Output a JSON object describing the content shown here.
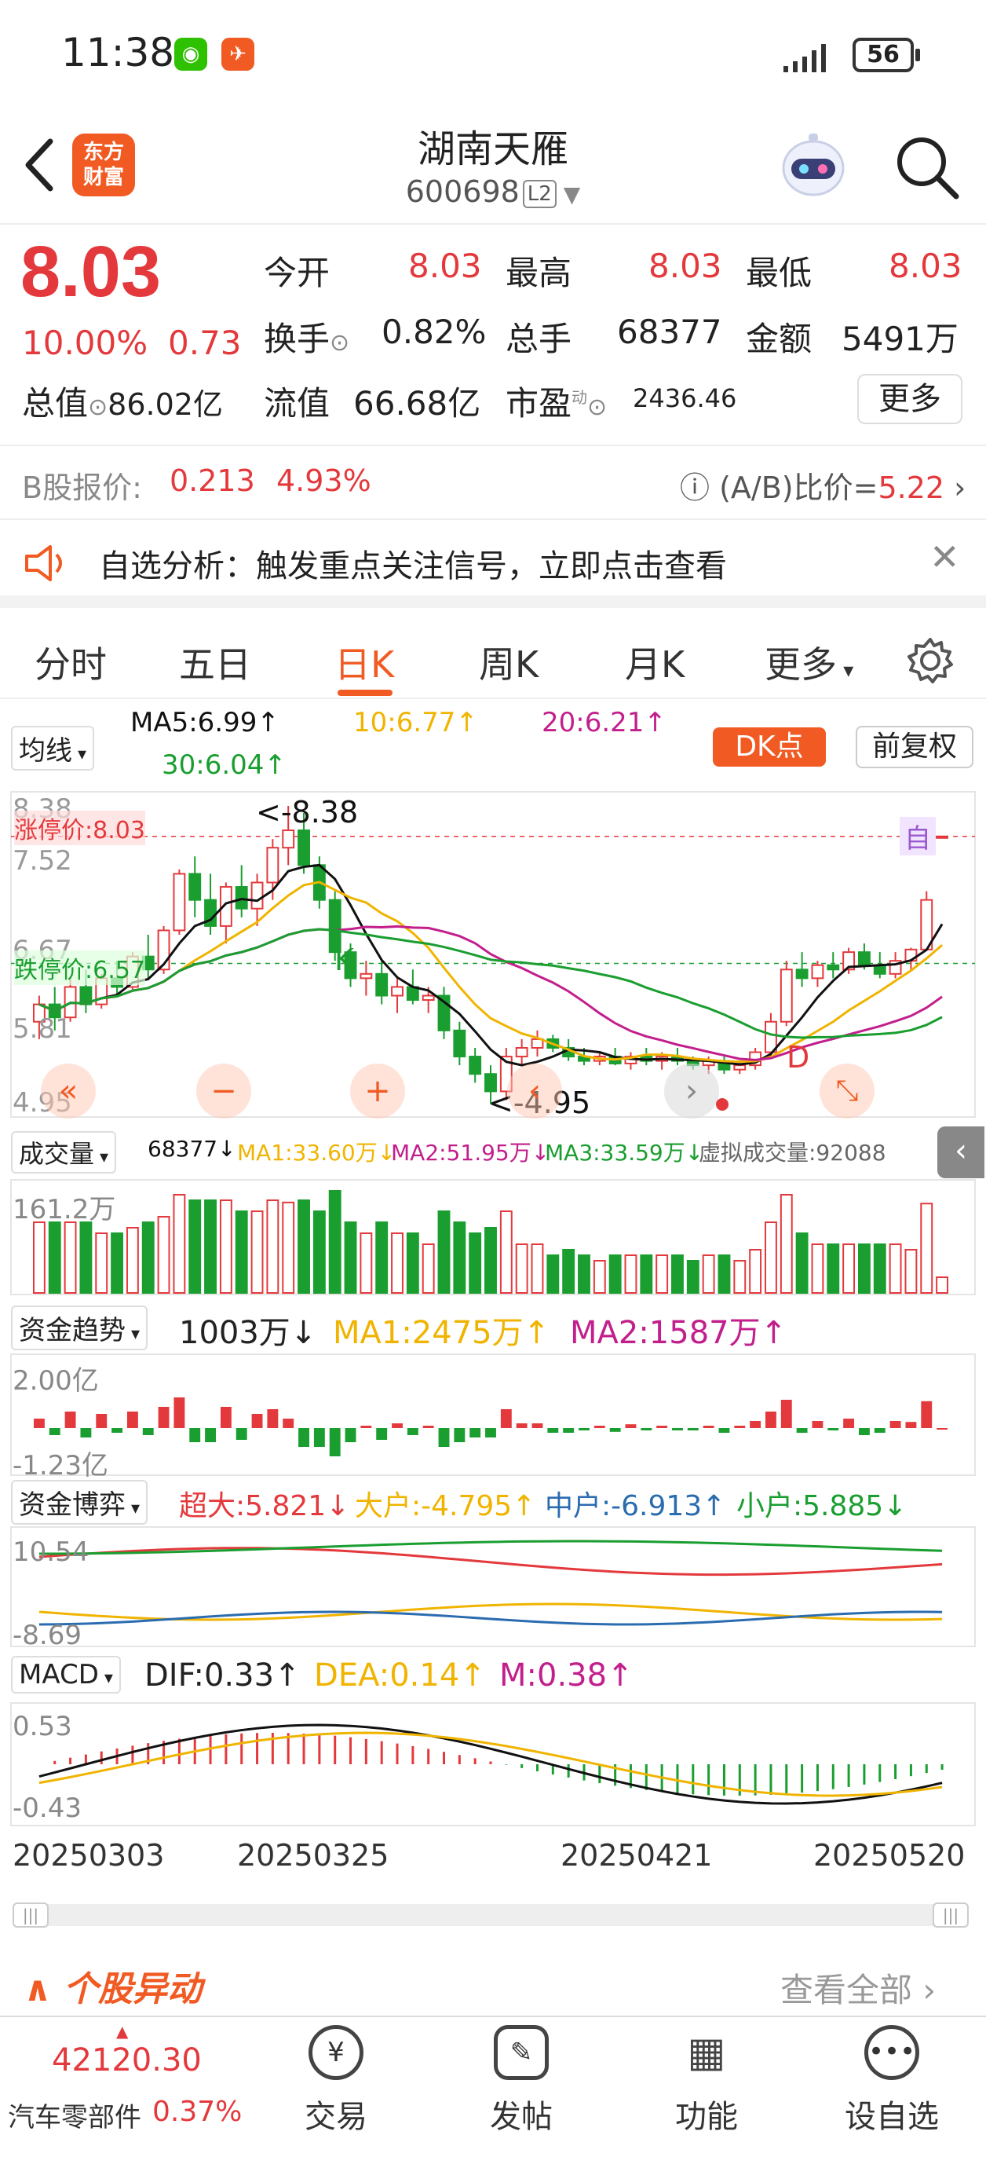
{
  "status": {
    "time": "11:38",
    "battery": "56"
  },
  "header": {
    "title": "湖南天雁",
    "code": "600698",
    "level": "L2",
    "logo_line1": "东方",
    "logo_line2": "财富"
  },
  "quote": {
    "price": "8.03",
    "pct": "10.00%",
    "chg": "0.73",
    "open_label": "今开",
    "open": "8.03",
    "high_label": "最高",
    "high": "8.03",
    "low_label": "最低",
    "low": "8.03",
    "turnover_label": "换手",
    "turnover": "0.82%",
    "vol_label": "总手",
    "vol": "68377",
    "amount_label": "金额",
    "amount": "5491万",
    "mcap_label": "总值",
    "mcap": "86.02亿",
    "float_label": "流值",
    "float": "66.68亿",
    "pe_label": "市盈",
    "pe_sup": "动",
    "pe": "2436.46",
    "more": "更多"
  },
  "bshare": {
    "label": "B股报价:",
    "price": "0.213",
    "pct": "4.93%",
    "ratio_label": "(A/B)比价=",
    "ratio": "5.22"
  },
  "banner": {
    "text": "自选分析：触发重点关注信号，立即点击查看"
  },
  "tabs": [
    "分时",
    "五日",
    "日K",
    "周K",
    "月K",
    "更多"
  ],
  "kchart": {
    "ma_select": "均线",
    "ma5": "MA5:6.99",
    "ma10": "10:6.77",
    "ma20": "20:6.21",
    "ma30": "30:6.04",
    "dk": "DK点",
    "adjust": "前复权",
    "limit_up": "涨停价:8.03",
    "limit_down": "跌停价:6.57",
    "y_top": "8.38",
    "y_2": "7.52",
    "y_3": "6.67",
    "y_4": "5.81",
    "y_bottom": "4.95",
    "max_tag": "<-8.38",
    "min_tag": "<-4.95",
    "self_tag": "自",
    "d_tag": "D",
    "k_tag": "K"
  },
  "volume": {
    "select": "成交量",
    "value": "68377",
    "ma1": "MA1:33.60万",
    "ma2": "MA2:51.95万",
    "ma3": "MA3:33.59万",
    "virtual": "虚拟成交量:92088",
    "y_top": "161.2万"
  },
  "fund": {
    "select": "资金趋势",
    "value": "1003万",
    "ma1": "MA1:2475万",
    "ma2": "MA2:1587万",
    "y_top": "2.00亿",
    "y_bottom": "-1.23亿"
  },
  "game": {
    "select": "资金博弈",
    "super": "超大:5.821",
    "big": "大户:-4.795",
    "mid": "中户:-6.913",
    "small": "小户:5.885",
    "y_top": "10.54",
    "y_bottom": "-8.69"
  },
  "macd": {
    "select": "MACD",
    "dif": "DIF:0.33",
    "dea": "DEA:0.14",
    "m": "M:0.38",
    "y_top": "0.53",
    "y_bottom": "-0.43"
  },
  "dates": [
    "20250303",
    "20250325",
    "20250421",
    "20250520"
  ],
  "movement": {
    "title": "个股异动",
    "link": "查看全部"
  },
  "bottom": {
    "index_value": "42120.30",
    "index_name": "汽车零部件",
    "index_pct": "0.37%",
    "trade": "交易",
    "post": "发帖",
    "func": "功能",
    "watch": "设自选"
  },
  "colors": {
    "up": "#e4393c",
    "down": "#1a9e30",
    "accent": "#f15a22",
    "ma5": "#111111",
    "ma10": "#f0b400",
    "ma20": "#c21f8c",
    "ma30": "#1a9e30"
  },
  "chart_data": {
    "type": "candlestick",
    "days": [
      {
        "o": 5.9,
        "h": 6.2,
        "l": 5.7,
        "c": 6.1
      },
      {
        "o": 6.1,
        "h": 6.3,
        "l": 5.8,
        "c": 5.95
      },
      {
        "o": 5.95,
        "h": 6.4,
        "l": 5.9,
        "c": 6.3
      },
      {
        "o": 6.3,
        "h": 6.5,
        "l": 6.0,
        "c": 6.1
      },
      {
        "o": 6.1,
        "h": 6.45,
        "l": 6.05,
        "c": 6.4
      },
      {
        "o": 6.4,
        "h": 6.6,
        "l": 6.2,
        "c": 6.3
      },
      {
        "o": 6.3,
        "h": 6.7,
        "l": 6.25,
        "c": 6.65
      },
      {
        "o": 6.65,
        "h": 6.9,
        "l": 6.4,
        "c": 6.5
      },
      {
        "o": 6.5,
        "h": 7.0,
        "l": 6.45,
        "c": 6.95
      },
      {
        "o": 6.95,
        "h": 7.65,
        "l": 6.9,
        "c": 7.6
      },
      {
        "o": 7.6,
        "h": 7.8,
        "l": 7.1,
        "c": 7.3
      },
      {
        "o": 7.3,
        "h": 7.6,
        "l": 6.9,
        "c": 7.0
      },
      {
        "o": 7.0,
        "h": 7.5,
        "l": 6.8,
        "c": 7.45
      },
      {
        "o": 7.45,
        "h": 7.7,
        "l": 7.1,
        "c": 7.2
      },
      {
        "o": 7.2,
        "h": 7.6,
        "l": 7.0,
        "c": 7.5
      },
      {
        "o": 7.5,
        "h": 8.0,
        "l": 7.3,
        "c": 7.9
      },
      {
        "o": 7.9,
        "h": 8.38,
        "l": 7.7,
        "c": 8.1
      },
      {
        "o": 8.1,
        "h": 8.3,
        "l": 7.6,
        "c": 7.7
      },
      {
        "o": 7.7,
        "h": 7.8,
        "l": 7.2,
        "c": 7.3
      },
      {
        "o": 7.3,
        "h": 7.4,
        "l": 6.6,
        "c": 6.7
      },
      {
        "o": 6.7,
        "h": 6.8,
        "l": 6.3,
        "c": 6.4
      },
      {
        "o": 6.4,
        "h": 6.6,
        "l": 6.2,
        "c": 6.45
      },
      {
        "o": 6.45,
        "h": 6.6,
        "l": 6.1,
        "c": 6.2
      },
      {
        "o": 6.2,
        "h": 6.4,
        "l": 6.0,
        "c": 6.3
      },
      {
        "o": 6.3,
        "h": 6.5,
        "l": 6.1,
        "c": 6.15
      },
      {
        "o": 6.15,
        "h": 6.3,
        "l": 6.0,
        "c": 6.2
      },
      {
        "o": 6.2,
        "h": 6.3,
        "l": 5.7,
        "c": 5.8
      },
      {
        "o": 5.8,
        "h": 5.9,
        "l": 5.4,
        "c": 5.5
      },
      {
        "o": 5.5,
        "h": 5.6,
        "l": 5.2,
        "c": 5.3
      },
      {
        "o": 5.3,
        "h": 5.4,
        "l": 4.95,
        "c": 5.1
      },
      {
        "o": 5.1,
        "h": 5.6,
        "l": 5.0,
        "c": 5.5
      },
      {
        "o": 5.5,
        "h": 5.7,
        "l": 5.4,
        "c": 5.6
      },
      {
        "o": 5.6,
        "h": 5.8,
        "l": 5.5,
        "c": 5.7
      },
      {
        "o": 5.7,
        "h": 5.75,
        "l": 5.55,
        "c": 5.6
      },
      {
        "o": 5.6,
        "h": 5.7,
        "l": 5.45,
        "c": 5.5
      },
      {
        "o": 5.5,
        "h": 5.6,
        "l": 5.4,
        "c": 5.45
      },
      {
        "o": 5.45,
        "h": 5.55,
        "l": 5.4,
        "c": 5.5
      },
      {
        "o": 5.5,
        "h": 5.6,
        "l": 5.4,
        "c": 5.42
      },
      {
        "o": 5.42,
        "h": 5.55,
        "l": 5.35,
        "c": 5.5
      },
      {
        "o": 5.5,
        "h": 5.6,
        "l": 5.4,
        "c": 5.45
      },
      {
        "o": 5.45,
        "h": 5.55,
        "l": 5.35,
        "c": 5.5
      },
      {
        "o": 5.5,
        "h": 5.6,
        "l": 5.4,
        "c": 5.45
      },
      {
        "o": 5.45,
        "h": 5.5,
        "l": 5.35,
        "c": 5.4
      },
      {
        "o": 5.4,
        "h": 5.5,
        "l": 5.3,
        "c": 5.45
      },
      {
        "o": 5.45,
        "h": 5.5,
        "l": 5.3,
        "c": 5.35
      },
      {
        "o": 5.35,
        "h": 5.45,
        "l": 5.3,
        "c": 5.4
      },
      {
        "o": 5.4,
        "h": 5.6,
        "l": 5.35,
        "c": 5.55
      },
      {
        "o": 5.55,
        "h": 6.0,
        "l": 5.5,
        "c": 5.9
      },
      {
        "o": 5.9,
        "h": 6.6,
        "l": 5.85,
        "c": 6.5
      },
      {
        "o": 6.5,
        "h": 6.7,
        "l": 6.3,
        "c": 6.4
      },
      {
        "o": 6.4,
        "h": 6.6,
        "l": 6.3,
        "c": 6.55
      },
      {
        "o": 6.55,
        "h": 6.7,
        "l": 6.4,
        "c": 6.5
      },
      {
        "o": 6.5,
        "h": 6.75,
        "l": 6.45,
        "c": 6.7
      },
      {
        "o": 6.7,
        "h": 6.8,
        "l": 6.5,
        "c": 6.55
      },
      {
        "o": 6.55,
        "h": 6.7,
        "l": 6.4,
        "c": 6.45
      },
      {
        "o": 6.45,
        "h": 6.7,
        "l": 6.4,
        "c": 6.6
      },
      {
        "o": 6.6,
        "h": 6.75,
        "l": 6.5,
        "c": 6.73
      },
      {
        "o": 6.73,
        "h": 7.4,
        "l": 6.73,
        "c": 7.3
      },
      {
        "o": 8.03,
        "h": 8.03,
        "l": 8.03,
        "c": 8.03
      }
    ]
  }
}
